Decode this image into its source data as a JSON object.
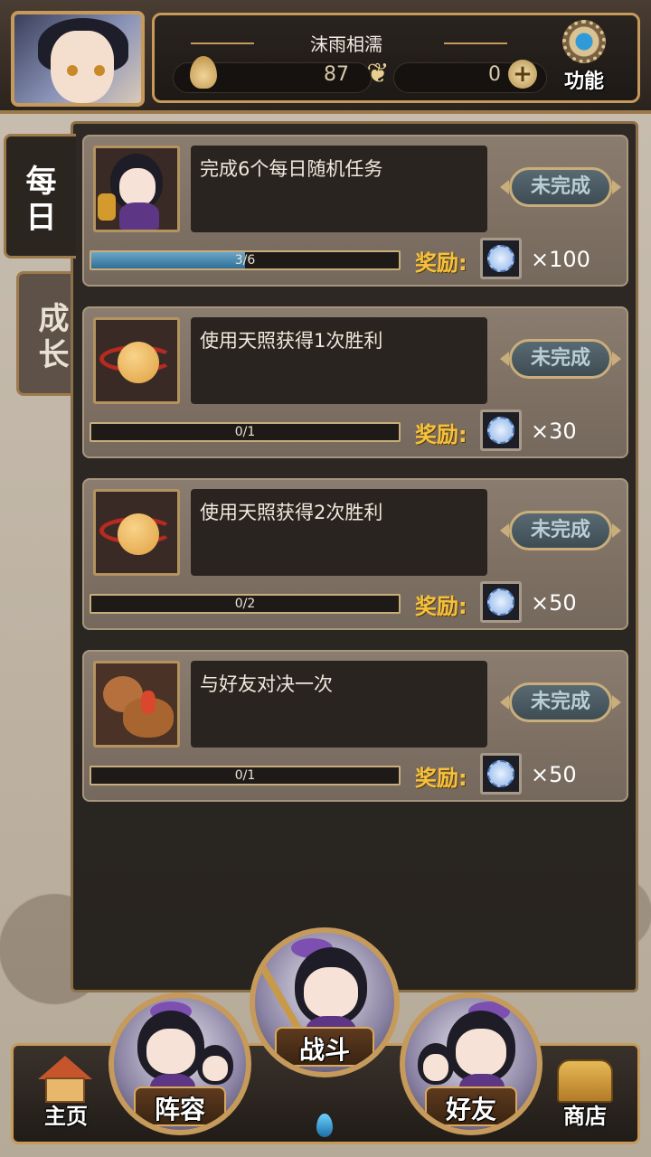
{
  "header": {
    "username": "沫雨相濡",
    "stamina": "87",
    "gold": "0",
    "function_label": "功能"
  },
  "tabs": {
    "daily": "每日",
    "growth": "成长"
  },
  "tasks": [
    {
      "title": "完成6个每日随机任务",
      "status": "未完成",
      "progress_text": "3/6",
      "progress": 0.5,
      "reward_label": "奖励:",
      "reward_amount": "×100"
    },
    {
      "title": "使用天照获得1次胜利",
      "status": "未完成",
      "progress_text": "0/1",
      "progress": 0,
      "reward_label": "奖励:",
      "reward_amount": "×30"
    },
    {
      "title": "使用天照获得2次胜利",
      "status": "未完成",
      "progress_text": "0/2",
      "progress": 0,
      "reward_label": "奖励:",
      "reward_amount": "×50"
    },
    {
      "title": "与好友对决一次",
      "status": "未完成",
      "progress_text": "0/1",
      "progress": 0,
      "reward_label": "奖励:",
      "reward_amount": "×50"
    }
  ],
  "nav": {
    "home": "主页",
    "team": "阵容",
    "battle": "战斗",
    "friends": "好友",
    "shop": "商店"
  },
  "icons": {
    "stamina": "flame-icon",
    "gold": "butterfly-icon",
    "add": "plus-icon",
    "function": "gear-icon",
    "reward": "coin-icon"
  },
  "colors": {
    "accent_gold": "#c69a5a",
    "reward_text": "#f6c23d",
    "progress_fill": "#2f6f96"
  }
}
